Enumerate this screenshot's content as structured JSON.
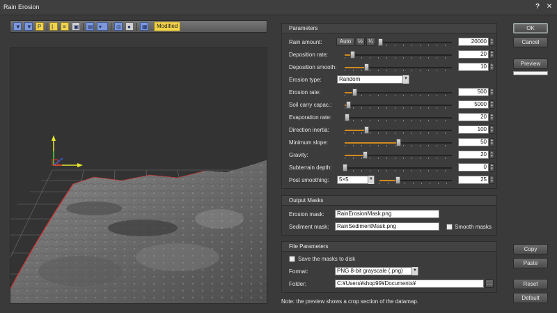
{
  "window": {
    "title": "Rain Erosion",
    "help": "?",
    "close": "✕"
  },
  "toolbar": {
    "icons": [
      "filter-x-icon",
      "filter-y-icon",
      "filter-p-icon",
      "chart-icon",
      "list-icon",
      "image-icon",
      "map-icon",
      "palette-icon",
      "globe-icon",
      "light-icon",
      "render-icon"
    ],
    "modified": "Modified"
  },
  "parameters": {
    "header": "Parameters",
    "rain_amount": {
      "label": "Rain amount:",
      "auto": "Auto",
      "half": "½",
      "quarter": "¼",
      "value": "20000",
      "level": 0.03
    },
    "deposition_rate": {
      "label": "Deposition rate:",
      "value": "20",
      "level": 0.07
    },
    "deposition_smooth": {
      "label": "Deposition smooth:",
      "value": "10",
      "level": 0.2
    },
    "erosion_type": {
      "label": "Erosion type:",
      "value": "Random"
    },
    "erosion_rate": {
      "label": "Erosion rate:",
      "value": "500",
      "level": 0.09
    },
    "soil_carry": {
      "label": "Soil carry capac.:",
      "value": "5000",
      "level": 0.03
    },
    "evaporation_rate": {
      "label": "Evaporation rate:",
      "value": "20",
      "level": 0.02
    },
    "direction_inertia": {
      "label": "Direction inertia:",
      "value": "100",
      "level": 0.2
    },
    "minimum_slope": {
      "label": "Minimum slope:",
      "value": "50",
      "level": 0.5
    },
    "gravity": {
      "label": "Gravity:",
      "value": "20",
      "level": 0.19
    },
    "subterrain_depth": {
      "label": "Subterrain depth:",
      "value": "0",
      "level": 0.0
    },
    "post_smoothing": {
      "label": "Post smoothing:",
      "combo": "5×5",
      "value": "25",
      "level": 0.25
    }
  },
  "output_masks": {
    "header": "Output Masks",
    "erosion_mask_label": "Erosion mask:",
    "erosion_mask": "RainErosionMask.png",
    "sediment_mask_label": "Sediment mask:",
    "sediment_mask": "RainSedimentMask.png",
    "smooth_masks": "Smooth masks"
  },
  "file_parameters": {
    "header": "File Parameters",
    "save_masks": "Save the masks to disk",
    "format_label": "Format:",
    "format": "PNG 8-bit grayscale (.png)",
    "folder_label": "Folder:",
    "folder": "C:¥Users¥shop99¥Documents¥",
    "browse": "..."
  },
  "note": "Note: the preview shows a crop section of the datamap.",
  "buttons": {
    "ok": "OK",
    "cancel": "Cancel",
    "preview": "Preview",
    "copy": "Copy",
    "paste": "Paste",
    "reset": "Reset",
    "default": "Default"
  },
  "colors": {
    "accent": "#f2d34a",
    "slider_fill": "#d28a1c",
    "background": "#3a3a3a"
  }
}
